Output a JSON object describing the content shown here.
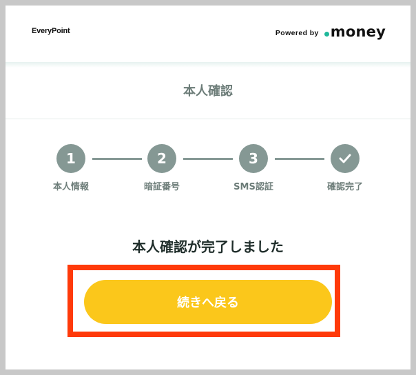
{
  "header": {
    "brand": "EveryPoint",
    "powered_by": "Powered by",
    "money_logo": "money",
    "money_dot_color": "#1fb89a"
  },
  "page": {
    "title": "本人確認"
  },
  "steps": [
    {
      "number": "1",
      "label": "本人情報",
      "state": "done"
    },
    {
      "number": "2",
      "label": "暗証番号",
      "state": "done"
    },
    {
      "number": "3",
      "label": "SMS認証",
      "state": "done"
    },
    {
      "icon": "check-icon",
      "label": "確認完了",
      "state": "current"
    }
  ],
  "result": {
    "message": "本人確認が完了しました"
  },
  "actions": {
    "back_button_label": "続きへ戻る",
    "button_color": "#fbc71b",
    "highlight_color": "#ff3a0a"
  }
}
